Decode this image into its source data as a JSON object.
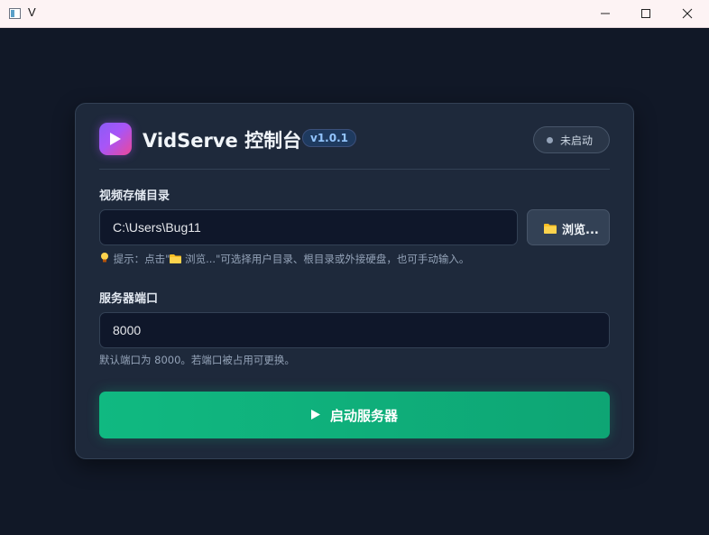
{
  "window": {
    "title": "V"
  },
  "header": {
    "app_title": "VidServe 控制台",
    "version": "v1.0.1",
    "status": "未启动"
  },
  "storage": {
    "label": "视频存储目录",
    "value": "C:\\Users\\Bug11",
    "browse_label": "浏览...",
    "hint_prefix": "提示：点击\"",
    "hint_browse": "浏览...",
    "hint_suffix": "\"可选择用户目录、根目录或外接硬盘，也可手动输入。"
  },
  "port": {
    "label": "服务器端口",
    "value": "8000",
    "hint": "默认端口为 8000。若端口被占用可更换。"
  },
  "start_button": {
    "label": "启动服务器"
  },
  "colors": {
    "accent": "#10b981",
    "card": "#1e293b",
    "background": "#111827",
    "logo": "#a855f7"
  }
}
